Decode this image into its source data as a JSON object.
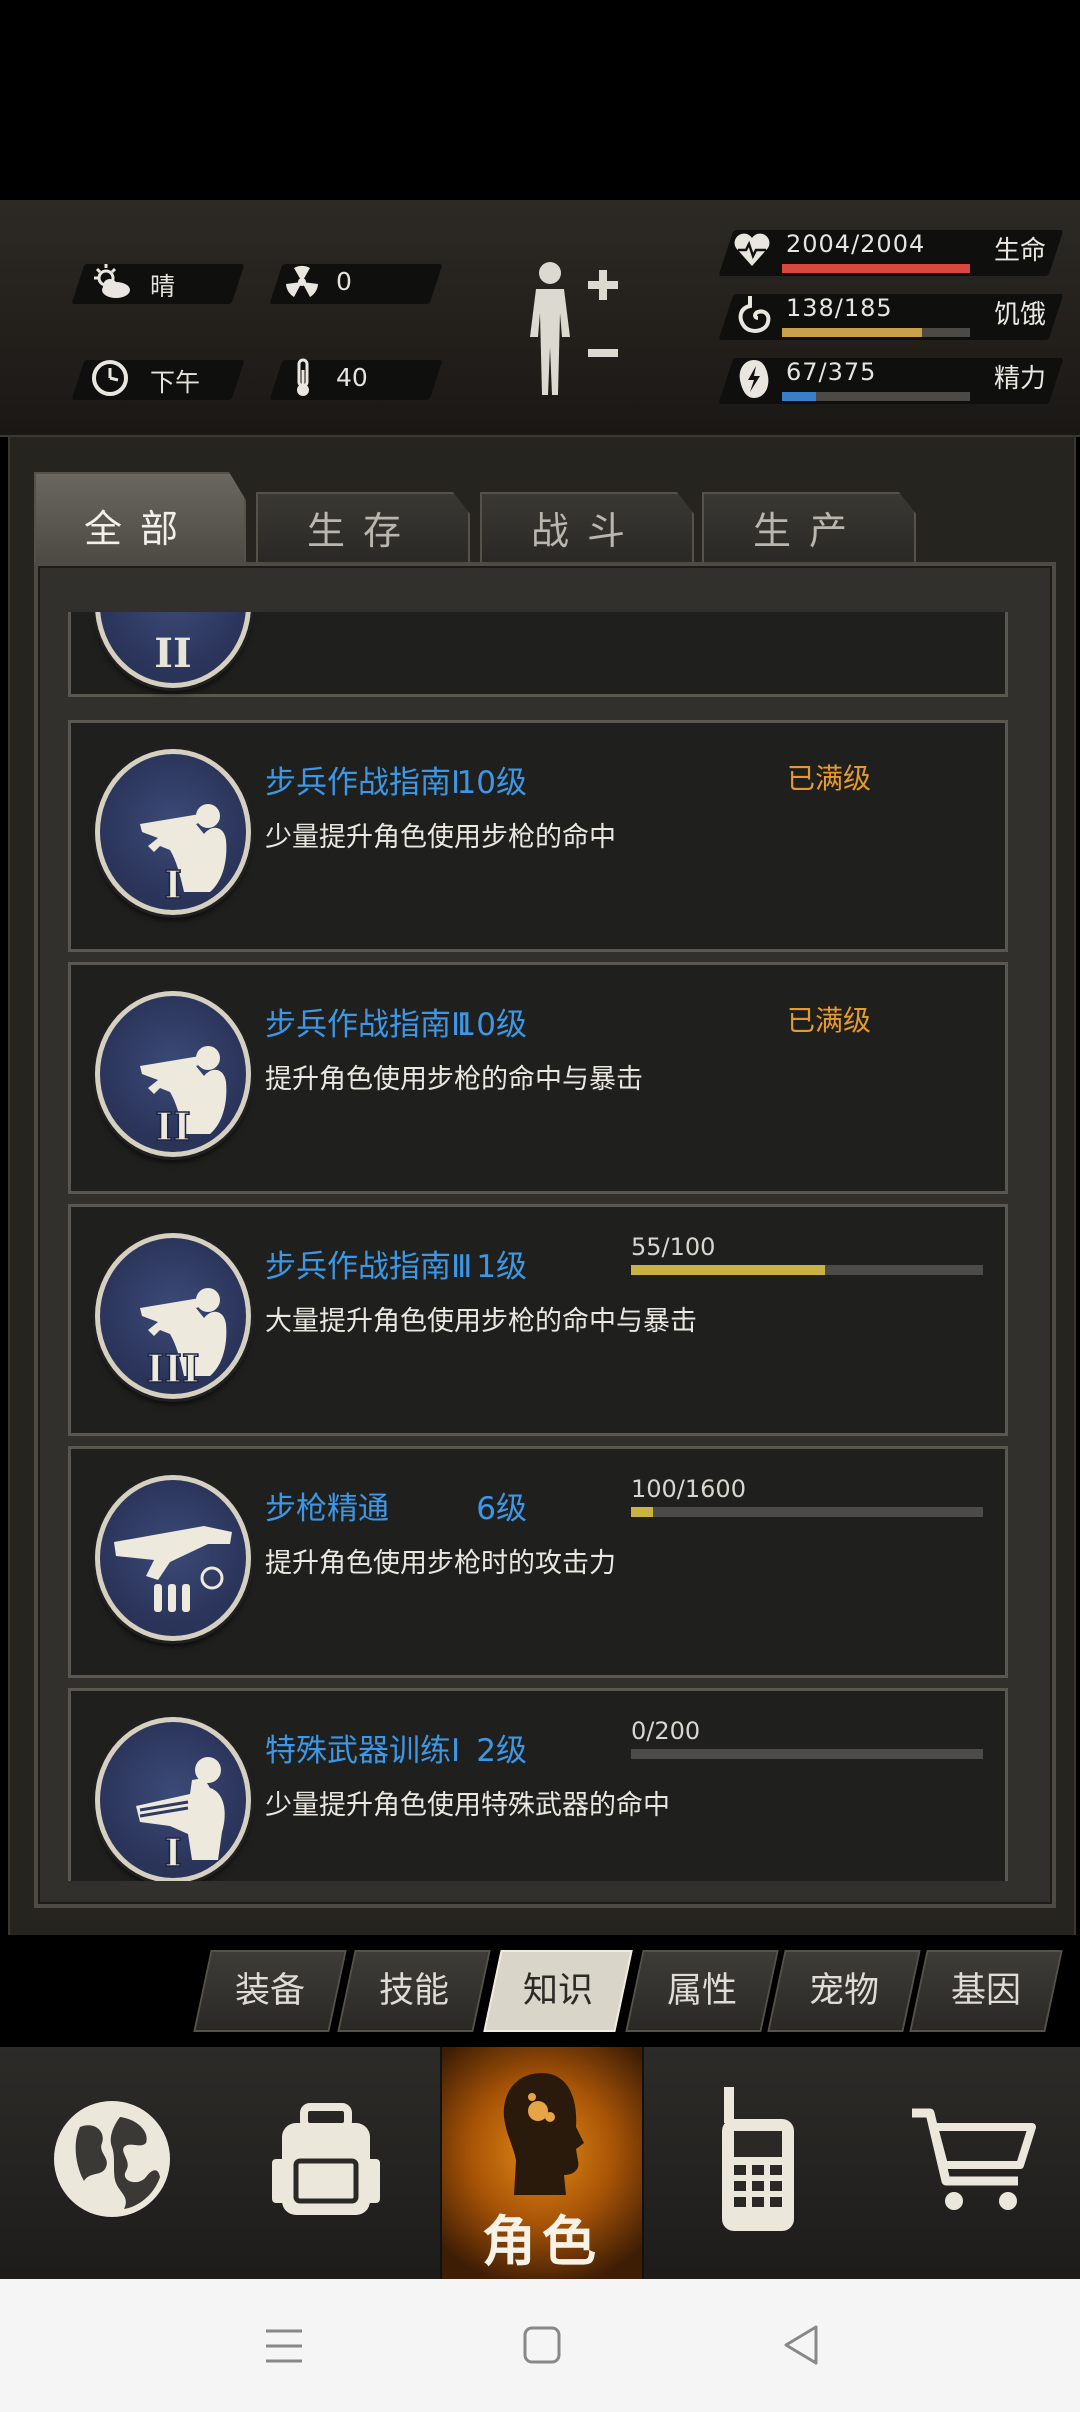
{
  "status": {
    "weather": "晴",
    "radiation": "0",
    "time": "下午",
    "temperature": "40",
    "health": {
      "value": "2004/2004",
      "label": "生命",
      "fraction": 1.0,
      "color": "#d9473f"
    },
    "hunger": {
      "value": "138/185",
      "label": "饥饿",
      "fraction": 0.746,
      "color": "#c9a14a"
    },
    "energy": {
      "value": "67/375",
      "label": "精力",
      "fraction": 0.179,
      "color": "#3a7ec9"
    }
  },
  "tabs": [
    "全部",
    "生存",
    "战斗",
    "生产"
  ],
  "skills": [
    {
      "title": "步兵作战指南Ⅰ",
      "level": "10级",
      "desc": "少量提升角色使用步枪的命中",
      "max": "已满级",
      "numeral": "I"
    },
    {
      "title": "步兵作战指南Ⅱ",
      "level": "10级",
      "desc": "提升角色使用步枪的命中与暴击",
      "max": "已满级",
      "numeral": "II"
    },
    {
      "title": "步兵作战指南Ⅲ",
      "level": "1级",
      "desc": "大量提升角色使用步枪的命中与暴击",
      "progress": "55/100",
      "fraction": 0.55,
      "numeral": "III"
    },
    {
      "title": "步枪精通",
      "level": "6级",
      "desc": "提升角色使用步枪时的攻击力",
      "progress": "100/1600",
      "fraction": 0.0625,
      "numeral": ""
    },
    {
      "title": "特殊武器训练Ⅰ",
      "level": "2级",
      "desc": "少量提升角色使用特殊武器的命中",
      "progress": "0/200",
      "fraction": 0.0,
      "numeral": "I"
    }
  ],
  "subnav": [
    "装备",
    "技能",
    "知识",
    "属性",
    "宠物",
    "基因"
  ],
  "subnav_active": "知识",
  "bottomnav": {
    "active_label": "角色"
  },
  "icons": [
    "weather-sun-cloud-icon",
    "radiation-icon",
    "clock-icon",
    "thermometer-icon",
    "body-plus-minus-icon",
    "heart-icon",
    "stomach-icon",
    "energy-icon",
    "globe-icon",
    "backpack-icon",
    "character-head-icon",
    "radio-icon",
    "cart-icon",
    "menu-icon",
    "home-icon",
    "back-icon"
  ]
}
